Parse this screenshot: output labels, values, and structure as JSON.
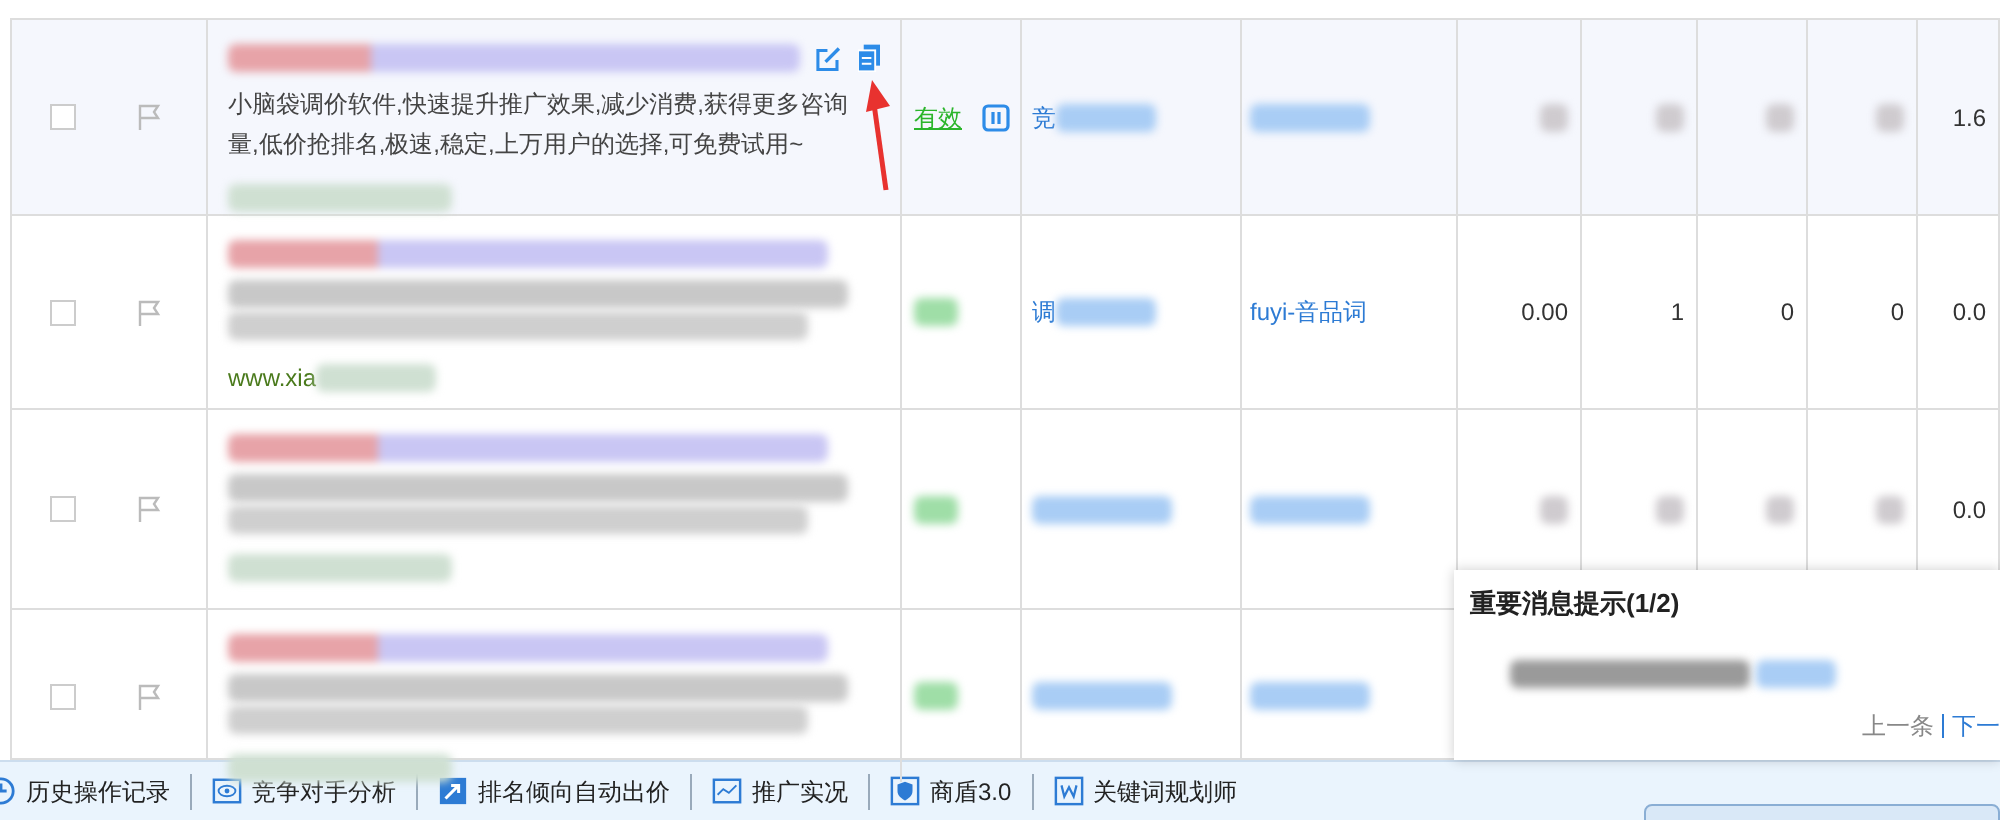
{
  "rows": [
    {
      "highlighted": true,
      "checked": false,
      "description": "小脑袋调价软件,快速提升推广效果,减少消费,获得更多咨询量,低价抢排名,极速,稳定,上万用户的选择,可免费试用~",
      "url": "",
      "status": "有效",
      "unit": "竞",
      "plan": "",
      "cells": [
        {
          "kind": "blurred"
        },
        {
          "kind": "blurred"
        },
        {
          "kind": "blurred"
        },
        {
          "kind": "blurred"
        },
        {
          "kind": "text",
          "text": "1.6"
        }
      ]
    },
    {
      "highlighted": false,
      "checked": false,
      "description": "",
      "url": "www.xia",
      "status": "",
      "unit": "调",
      "plan": "fuyi-音品词",
      "cells": [
        {
          "kind": "text",
          "text": "0.00"
        },
        {
          "kind": "text",
          "text": "1"
        },
        {
          "kind": "text",
          "text": "0"
        },
        {
          "kind": "text",
          "text": "0"
        },
        {
          "kind": "text",
          "text": "0.0"
        }
      ]
    },
    {
      "highlighted": false,
      "checked": false,
      "description": "",
      "url": "",
      "status": "",
      "unit": "",
      "plan": "",
      "cells": [
        {
          "kind": "blurred"
        },
        {
          "kind": "blurred"
        },
        {
          "kind": "blurred"
        },
        {
          "kind": "blurred"
        },
        {
          "kind": "text",
          "text": "0.0"
        }
      ]
    },
    {
      "highlighted": false,
      "checked": false,
      "description": "",
      "url": "",
      "status": "",
      "unit": "",
      "plan": "",
      "cells": []
    }
  ],
  "popup": {
    "title": "重要消息提示(1/2)",
    "prev": "上一条",
    "next": "下一"
  },
  "toolbar": [
    {
      "kind": "history",
      "label": "历史操作记录"
    },
    {
      "kind": "eye",
      "label": "竞争对手分析"
    },
    {
      "kind": "arrow",
      "label": "排名倾向自动出价"
    },
    {
      "kind": "chart",
      "label": "推广实况"
    },
    {
      "kind": "shield",
      "label": "商盾3.0"
    },
    {
      "kind": "word",
      "label": "关键词规划师"
    }
  ]
}
